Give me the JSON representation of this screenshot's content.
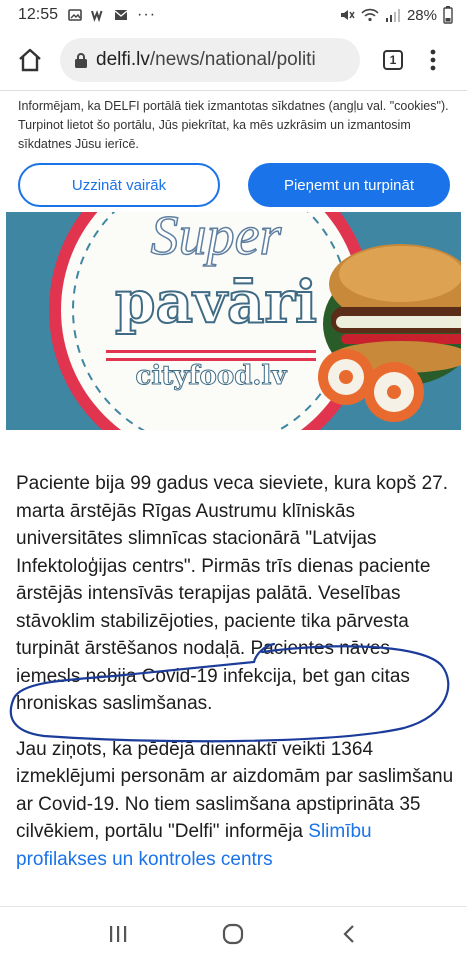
{
  "status_bar": {
    "time": "12:55",
    "notification_icons": [
      "image-icon",
      "w-app-icon",
      "mail-icon",
      "more-dots-icon"
    ],
    "more_dots": "···",
    "battery": "28%"
  },
  "browser": {
    "url_domain": "delfi.lv",
    "url_path": "/news/national/politi",
    "tab_count": "1"
  },
  "cookie_banner": {
    "text": "Informējam, ka DELFI portālā tiek izmantotas sīkdatnes (angļu val. \"cookies\"). Turpinot lietot šo portālu, Jūs piekrītat, ka mēs uzkrāsim un izmantosim sīkdatnes Jūsu ierīcē.",
    "learn_more": "Uzzināt vairāk",
    "accept": "Pieņemt un turpināt"
  },
  "ad": {
    "script_word": "Super",
    "headline": "pavāri",
    "site": "cityfood.lv"
  },
  "article": {
    "para1_main": "Paciente bija 99 gadus veca sieviete, kura kopš 27. marta ārstējās Rīgas Austrumu klīniskās universitātes slimnīcas stacionārā \"Latvijas Infektoloģijas centrs\". Pirmās trīs dienas paciente ārstējās intensīvās terapijas palātā. Veselības stāvoklim stabilizējoties, paciente tika pārvesta turpināt ārstēšanos nodaļā.",
    "para1_highlight": "Pacientes nāves iemesls nebija Covid-19 infekcija, bet gan citas hroniskas saslimšanas.",
    "para2_text": "Jau ziņots, ka pēdējā diennaktī veikti 1364 izmeklējumi personām ar aizdomām par saslimšanu ar Covid-19. No tiem saslimšana apstiprināta 35 cilvēkiem, portālu \"Delfi\" informēja",
    "para2_link": "Slimību profilakses un kontroles centrs"
  },
  "colors": {
    "accent": "#1a73e8",
    "ad_bg": "#3f86a3",
    "ad_scallop": "#e0344f",
    "pen": "#1c3c9a"
  }
}
